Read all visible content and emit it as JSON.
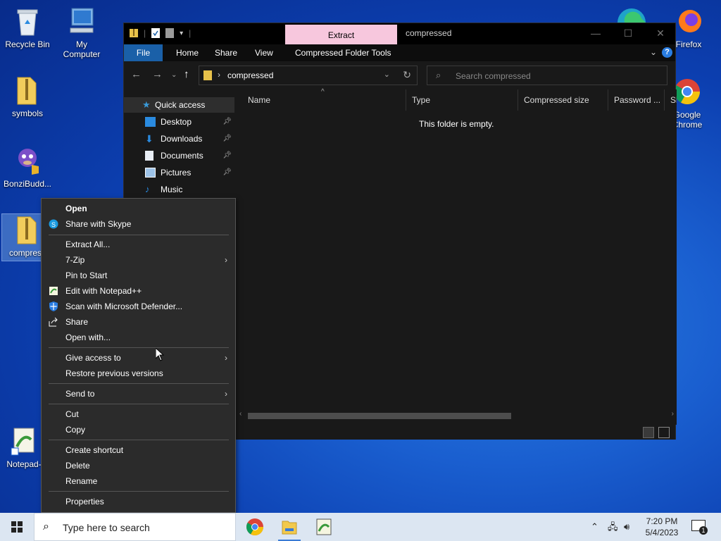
{
  "desktop": {
    "icons": [
      {
        "label": "Recycle Bin"
      },
      {
        "label": "My Computer"
      },
      {
        "label": "symbols"
      },
      {
        "label": "BonziBudd..."
      },
      {
        "label": "compress"
      },
      {
        "label": "Notepad-"
      },
      {
        "label": "Firefox"
      },
      {
        "label": "Google Chrome"
      }
    ]
  },
  "window": {
    "title": "compressed",
    "context_tab": "Extract",
    "ribbon_tabs": [
      "File",
      "Home",
      "Share",
      "View",
      "Compressed Folder Tools"
    ],
    "help": "?",
    "address_path": "compressed",
    "search_placeholder": "Search compressed",
    "nav_items": [
      {
        "label": "Quick access",
        "icon": "star-icon",
        "pinned": false
      },
      {
        "label": "Desktop",
        "icon": "desktop-icon",
        "pinned": true
      },
      {
        "label": "Downloads",
        "icon": "download-icon",
        "pinned": true
      },
      {
        "label": "Documents",
        "icon": "document-icon",
        "pinned": true
      },
      {
        "label": "Pictures",
        "icon": "picture-icon",
        "pinned": true
      },
      {
        "label": "Music",
        "icon": "music-icon",
        "pinned": false
      }
    ],
    "columns": [
      "Name",
      "Type",
      "Compressed size",
      "Password ...",
      "Si"
    ],
    "empty_message": "This folder is empty."
  },
  "context_menu": {
    "items": [
      {
        "label": "Open",
        "bold": true
      },
      {
        "label": "Share with Skype",
        "icon": "skype-icon"
      },
      {
        "label": "Extract All..."
      },
      {
        "label": "7-Zip",
        "submenu": true
      },
      {
        "label": "Pin to Start"
      },
      {
        "label": "Edit with Notepad++",
        "icon": "notepadpp-icon"
      },
      {
        "label": "Scan with Microsoft Defender...",
        "icon": "defender-icon"
      },
      {
        "label": "Share",
        "icon": "share-icon"
      },
      {
        "label": "Open with..."
      },
      {
        "label": "Give access to",
        "submenu": true
      },
      {
        "label": "Restore previous versions"
      },
      {
        "label": "Send to",
        "submenu": true
      },
      {
        "label": "Cut"
      },
      {
        "label": "Copy"
      },
      {
        "label": "Create shortcut"
      },
      {
        "label": "Delete"
      },
      {
        "label": "Rename"
      },
      {
        "label": "Properties"
      }
    ]
  },
  "taskbar": {
    "search_placeholder": "Type here to search",
    "time": "7:20 PM",
    "date": "5/4/2023",
    "notification_count": "1"
  },
  "colors": {
    "context_tab": "#f7c7dd",
    "file_tab": "#1a60a8",
    "menu_bg": "#2b2b2b",
    "window_bg": "#191919",
    "taskbar_bg": "#dce6f2"
  }
}
